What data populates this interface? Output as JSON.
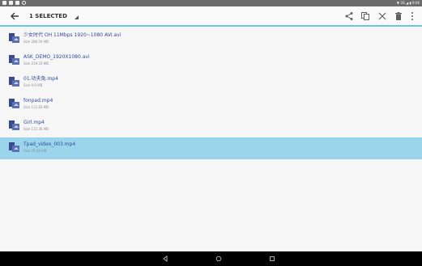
{
  "status_bar": {
    "left_icons": [
      "image-icon",
      "image-icon",
      "sd-card-icon",
      "alarm-icon"
    ],
    "right_text": "▼ 3G ◢ ▮ 9:06",
    "colors": {
      "background": "#6b6b6b"
    }
  },
  "toolbar": {
    "back_icon": "arrow-left-icon",
    "selection_label": "1 SELECTED",
    "actions": [
      "share-icon",
      "copy-icon",
      "cut-icon",
      "delete-icon",
      "more-vert-icon"
    ],
    "colors": {
      "accent_underline": "#66c6e6"
    }
  },
  "files": [
    {
      "name": "少女时代 OH 11Mbps 1920~1080 AVI.avi",
      "size": "Size 286.59 MB",
      "selected": false,
      "icon": "video-file-icon"
    },
    {
      "name": "ASK_DEMO_1920X1080.avi",
      "size": "Size 239.33 MB",
      "selected": false,
      "icon": "video-file-icon"
    },
    {
      "name": "01.功夫兔.mp4",
      "size": "Size 9.9 MB",
      "selected": false,
      "icon": "video-file-icon"
    },
    {
      "name": "fonpad.mp4",
      "size": "Size 111.83 MB",
      "selected": false,
      "icon": "video-file-icon"
    },
    {
      "name": "Girl.mp4",
      "size": "Size 115.36 MB",
      "selected": false,
      "icon": "video-file-icon"
    },
    {
      "name": "Tpad_video_003.mp4",
      "size": "Size 76.84 MB",
      "selected": true,
      "icon": "video-file-icon"
    }
  ],
  "nav_bar": {
    "buttons": [
      "nav-back-icon",
      "nav-home-icon",
      "nav-recents-icon"
    ],
    "colors": {
      "background": "#000000"
    }
  },
  "colors": {
    "selected_row": "#9bd5ec",
    "file_name": "#2f4a9b",
    "file_size": "#8a8f95",
    "page_background": "#f6f6f6"
  }
}
